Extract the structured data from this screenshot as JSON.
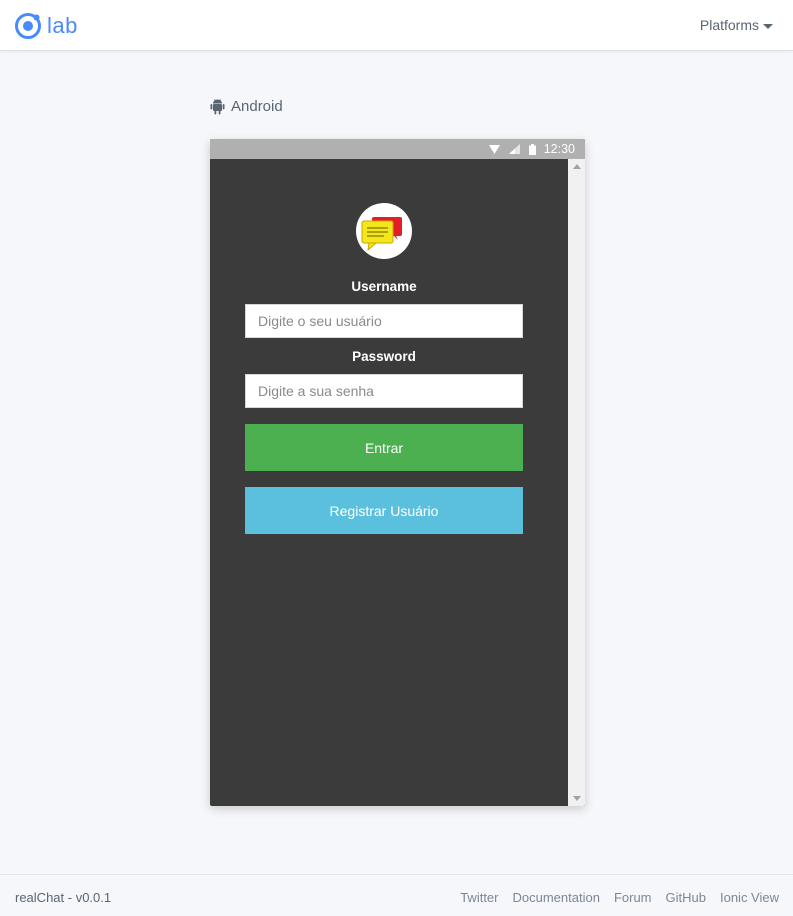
{
  "header": {
    "logo_text": "lab",
    "platforms_label": "Platforms"
  },
  "platform": {
    "name": "Android",
    "icon": "android-icon"
  },
  "device": {
    "status_bar": {
      "time": "12:30",
      "icons": [
        "wifi-icon",
        "signal-icon",
        "battery-icon"
      ]
    },
    "app": {
      "logo_icon": "chat-bubbles-icon",
      "username_label": "Username",
      "username_placeholder": "Digite o seu usuário",
      "password_label": "Password",
      "password_placeholder": "Digite a sua senha",
      "login_button": "Entrar",
      "register_button": "Registrar Usuário"
    }
  },
  "footer": {
    "version": "realChat - v0.0.1",
    "links": [
      "Twitter",
      "Documentation",
      "Forum",
      "GitHub",
      "Ionic View"
    ]
  },
  "colors": {
    "brand": "#4a8bfc",
    "device_bg": "#3b3b3b",
    "login_button": "#4caf50",
    "register_button": "#5bc0de"
  }
}
